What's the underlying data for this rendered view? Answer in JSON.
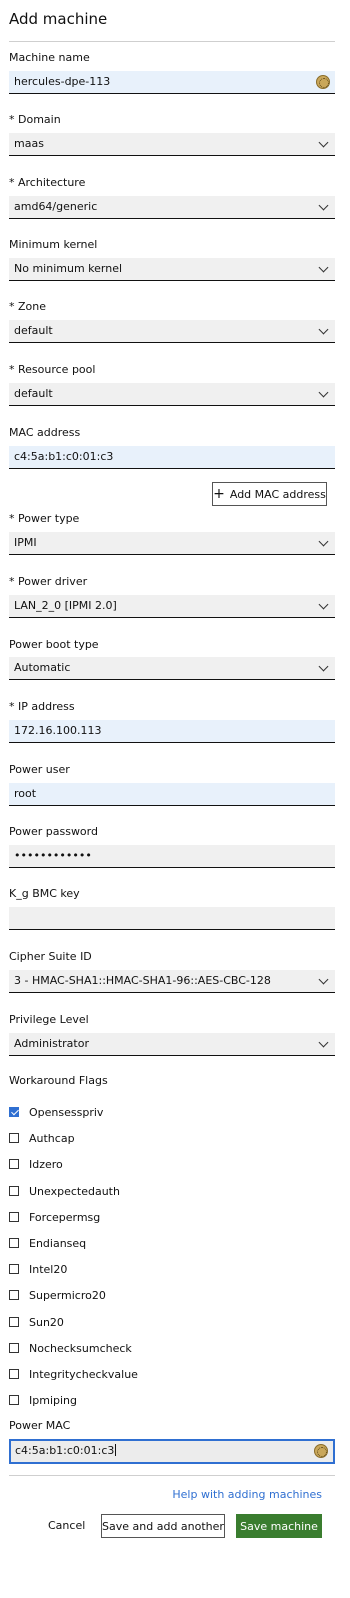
{
  "form": {
    "title": "Add machine",
    "machine_name": {
      "label": "Machine name",
      "value": "hercules-dpe-113"
    },
    "domain": {
      "label": "* Domain",
      "value": "maas"
    },
    "architecture": {
      "label": "* Architecture",
      "value": "amd64/generic"
    },
    "minimum_kernel": {
      "label": "Minimum kernel",
      "value": "No minimum kernel"
    },
    "zone": {
      "label": "* Zone",
      "value": "default"
    },
    "resource_pool": {
      "label": "* Resource pool",
      "value": "default"
    },
    "mac_address": {
      "label": "MAC address",
      "value": "c4:5a:b1:c0:01:c3"
    },
    "add_mac_label": "Add MAC address",
    "power_type": {
      "label": "* Power type",
      "value": "IPMI"
    },
    "power_driver": {
      "label": "* Power driver",
      "value": "LAN_2_0 [IPMI 2.0]"
    },
    "power_boot_type": {
      "label": "Power boot type",
      "value": "Automatic"
    },
    "ip_address": {
      "label": "* IP address",
      "value": "172.16.100.113"
    },
    "power_user": {
      "label": "Power user",
      "value": "root"
    },
    "power_password": {
      "label": "Power password",
      "value": "••••••••••••"
    },
    "k_g_bmc_key": {
      "label": "K_g BMC key",
      "value": ""
    },
    "cipher_suite": {
      "label": "Cipher Suite ID",
      "value": "3 - HMAC-SHA1::HMAC-SHA1-96::AES-CBC-128"
    },
    "privilege_level": {
      "label": "Privilege Level",
      "value": "Administrator"
    },
    "workaround_flags": {
      "label": "Workaround Flags",
      "items": [
        {
          "label": "Opensesspriv",
          "checked": true
        },
        {
          "label": "Authcap",
          "checked": false
        },
        {
          "label": "Idzero",
          "checked": false
        },
        {
          "label": "Unexpectedauth",
          "checked": false
        },
        {
          "label": "Forcepermsg",
          "checked": false
        },
        {
          "label": "Endianseq",
          "checked": false
        },
        {
          "label": "Intel20",
          "checked": false
        },
        {
          "label": "Supermicro20",
          "checked": false
        },
        {
          "label": "Sun20",
          "checked": false
        },
        {
          "label": "Nochecksumcheck",
          "checked": false
        },
        {
          "label": "Integritycheckvalue",
          "checked": false
        },
        {
          "label": "Ipmiping",
          "checked": false
        }
      ]
    },
    "power_mac": {
      "label": "Power MAC",
      "value": "c4:5a:b1:c0:01:c3"
    }
  },
  "footer": {
    "help_link": "Help with adding machines",
    "cancel_label": "Cancel",
    "save_another_label": "Save and add another",
    "save_label": "Save machine"
  },
  "colors": {
    "accent": "#2f6fd1",
    "primary_button": "#3a7d2f",
    "field_bg": "#f0f0f0",
    "field_bg_filled": "#e8f1fb"
  }
}
